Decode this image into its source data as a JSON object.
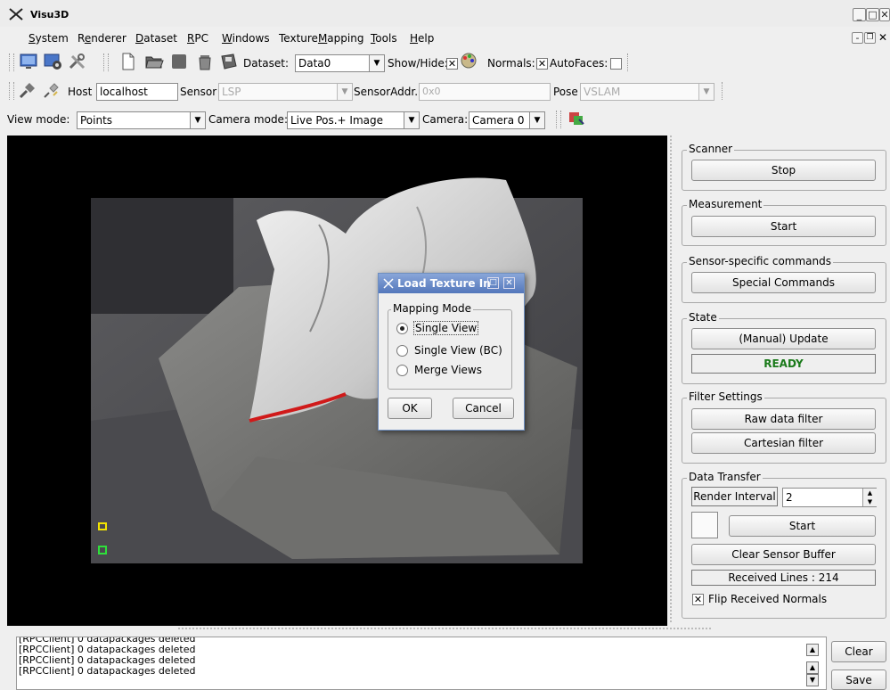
{
  "window": {
    "title": "Visu3D",
    "min_icon": "minimize-icon",
    "max_icon": "maximize-icon",
    "close_icon": "close-icon"
  },
  "menu": [
    {
      "label": "System",
      "u": "S",
      "rest": "ystem"
    },
    {
      "label": "Renderer",
      "u": "e",
      "pre": "R",
      "rest": "nderer"
    },
    {
      "label": "Dataset",
      "u": "D",
      "rest": "ataset"
    },
    {
      "label": "RPC",
      "u": "R",
      "rest": "PC"
    },
    {
      "label": "Windows",
      "u": "W",
      "rest": "indows"
    },
    {
      "label": "TextureMapping",
      "pre": "Texture",
      "u": "M",
      "rest": "apping"
    },
    {
      "label": "Tools",
      "u": "T",
      "rest": "ools"
    },
    {
      "label": "Help",
      "u": "H",
      "rest": "elp"
    }
  ],
  "toolbar1": {
    "dataset_label": "Dataset:",
    "dataset_value": "Data0",
    "showhide_label": "Show/Hide:",
    "normals_label": "Normals:",
    "autofaces_label": "AutoFaces:"
  },
  "toolbar2": {
    "host_label": "Host",
    "host_value": "localhost",
    "sensor_label": "Sensor",
    "sensor_value": "LSP",
    "sensoraddr_label": "SensorAddr.",
    "sensoraddr_value": "0x0",
    "pose_label": "Pose",
    "pose_value": "VSLAM"
  },
  "toolbar3": {
    "viewmode_label": "View mode:",
    "viewmode_value": "Points",
    "cameramode_label": "Camera mode:",
    "cameramode_value": "Live Pos.+ Image",
    "camera_label": "Camera:",
    "camera_value": "Camera 0"
  },
  "panel": {
    "scanner": {
      "title": "Scanner",
      "button": "Stop"
    },
    "measurement": {
      "title": "Measurement",
      "button": "Start"
    },
    "sensor_cmds": {
      "title": "Sensor-specific commands",
      "button": "Special Commands"
    },
    "state": {
      "title": "State",
      "button": "(Manual) Update",
      "status": "READY",
      "status_color": "#1a7a1a"
    },
    "filter": {
      "title": "Filter Settings",
      "raw": "Raw data filter",
      "cartesian": "Cartesian filter"
    },
    "transfer": {
      "title": "Data Transfer",
      "render_interval_label": "Render Interval",
      "render_interval_value": "2",
      "start": "Start",
      "clear_buffer": "Clear Sensor Buffer",
      "received": "Received Lines : 214",
      "flip_label": "Flip Received Normals"
    }
  },
  "dialog": {
    "title": "Load Texture In",
    "group": "Mapping Mode",
    "options": [
      "Single View",
      "Single View (BC)",
      "Merge Views"
    ],
    "selected": "Single View",
    "ok": "OK",
    "cancel": "Cancel"
  },
  "log": {
    "lines": [
      "[RPCClient] 0 datapackages deleted",
      "[RPCClient] 0 datapackages deleted",
      "[RPCClient] 0 datapackages deleted",
      "[RPCClient] 0 datapackages deleted"
    ],
    "clear": "Clear",
    "save": "Save"
  }
}
